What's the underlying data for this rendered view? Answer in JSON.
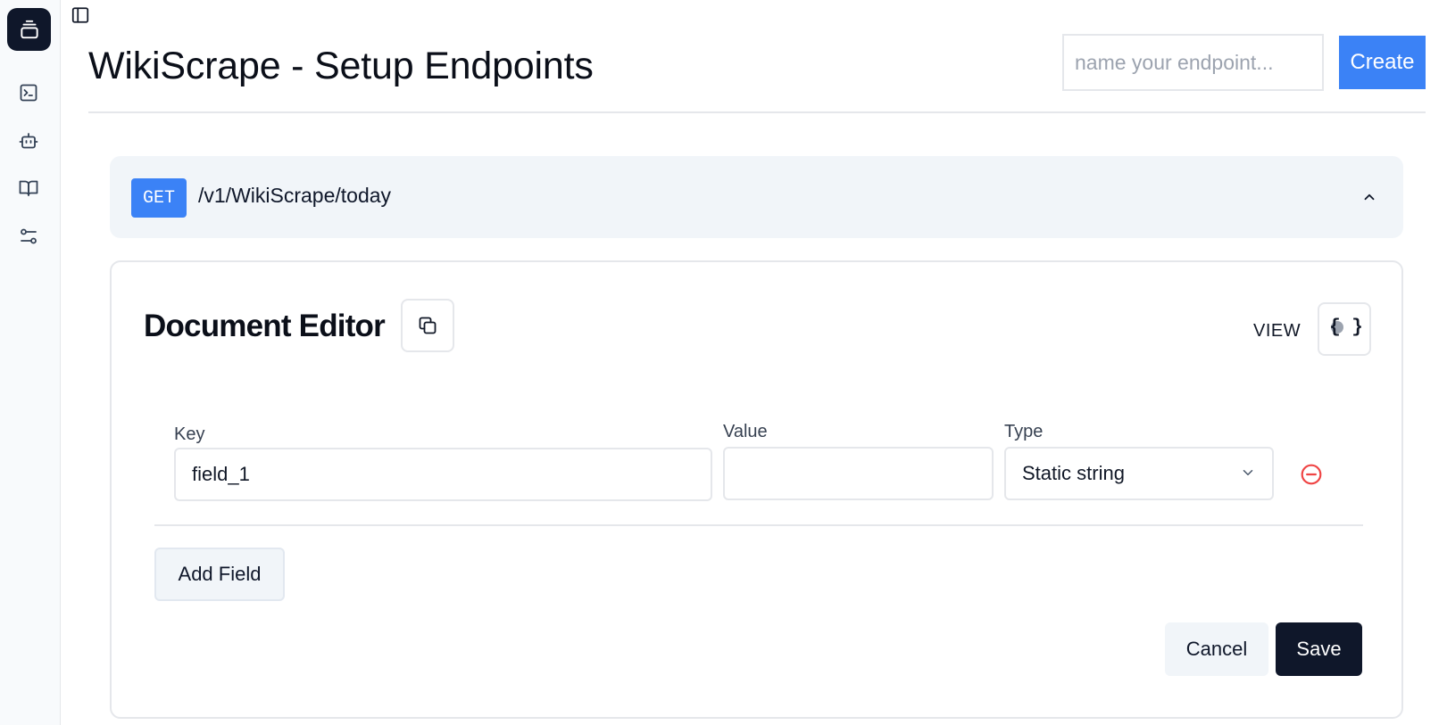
{
  "app": {
    "title": "WikiScrape - Setup Endpoints"
  },
  "rail": {
    "items": [
      {
        "icon": "app-logo-icon"
      },
      {
        "icon": "terminal-icon"
      },
      {
        "icon": "bot-icon"
      },
      {
        "icon": "book-open-icon"
      },
      {
        "icon": "settings-sliders-icon"
      }
    ]
  },
  "header": {
    "endpoint_name_placeholder": "name your endpoint...",
    "endpoint_name_value": "",
    "create_label": "Create"
  },
  "endpoint": {
    "method": "GET",
    "path": "/v1/WikiScrape/today",
    "expanded": true
  },
  "editor": {
    "title": "Document Editor",
    "view_label": "VIEW",
    "view_toggle_symbol": "{ }",
    "fields": [
      {
        "key_label": "Key",
        "key_value": "field_1",
        "value_label": "Value",
        "value_value": "",
        "type_label": "Type",
        "type_value": "Static string"
      }
    ],
    "add_field_label": "Add Field",
    "cancel_label": "Cancel",
    "save_label": "Save"
  },
  "colors": {
    "accent": "#3b82f6",
    "dark": "#0f172a",
    "danger": "#ef4444",
    "muted_bg": "#f1f5f9",
    "border": "#e5e7eb"
  }
}
